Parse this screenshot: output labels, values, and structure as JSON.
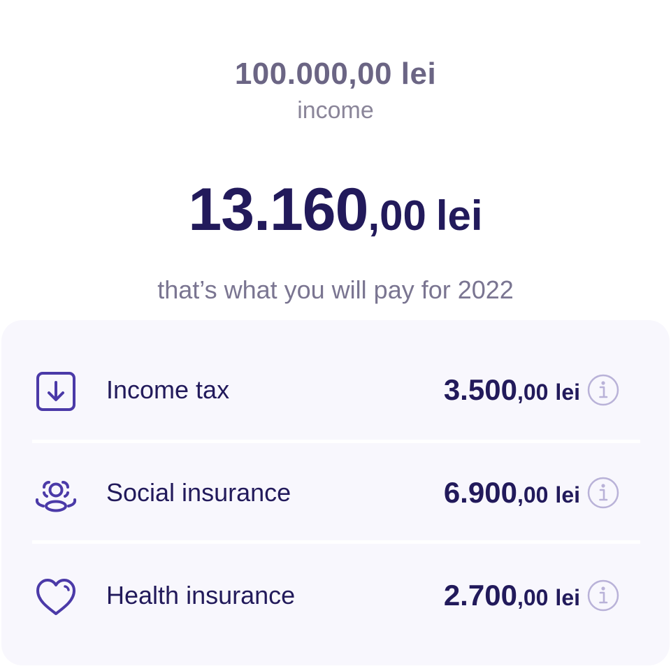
{
  "summary": {
    "income_amount": "100.000,00 lei",
    "income_label": "income",
    "total_int": "13.160",
    "total_dec": ",00",
    "total_currency": "lei",
    "total_caption": "that’s what you will pay for 2022"
  },
  "breakdown": [
    {
      "icon": "download-box-icon",
      "label": "Income tax",
      "value_int": "3.500",
      "value_dec": ",00",
      "currency": "lei"
    },
    {
      "icon": "people-group-icon",
      "label": "Social insurance",
      "value_int": "6.900",
      "value_dec": ",00",
      "currency": "lei"
    },
    {
      "icon": "heart-icon",
      "label": "Health insurance",
      "value_int": "2.700",
      "value_dec": ",00",
      "currency": "lei"
    }
  ],
  "colors": {
    "accent": "#4b3aa8",
    "text_dark": "#221a5b",
    "text_muted": "#7a7591",
    "card_bg": "#f8f7fd",
    "info_icon": "#b9b2d8"
  }
}
